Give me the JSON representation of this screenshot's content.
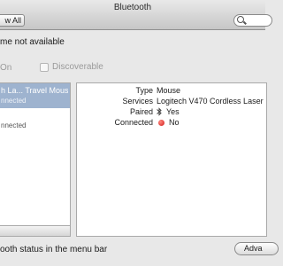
{
  "window": {
    "title": "Bluetooth"
  },
  "toolbar": {
    "show_all_label": "w All"
  },
  "name_status": "me not available",
  "options": {
    "power_label": "On",
    "discoverable_label": "Discoverable",
    "discoverable_checked": false
  },
  "devices": [
    {
      "name": "h La... Travel Mouse",
      "status": "nnected"
    },
    {
      "status": "nnected"
    }
  ],
  "details": {
    "rows": [
      {
        "label": "Type",
        "value": "Mouse"
      },
      {
        "label": "Services",
        "value": "Logitech V470 Cordless Laser"
      },
      {
        "label": "Paired",
        "value": "Yes",
        "icon": "bluetooth-icon"
      },
      {
        "label": "Connected",
        "value": "No",
        "icon": "red-status-dot-icon",
        "status_color": "#d01818"
      }
    ]
  },
  "footer": {
    "menubar_label": "ooth status in the menu bar",
    "advanced_label": "Adva"
  },
  "colors": {
    "selection": "#9eb3cf"
  }
}
